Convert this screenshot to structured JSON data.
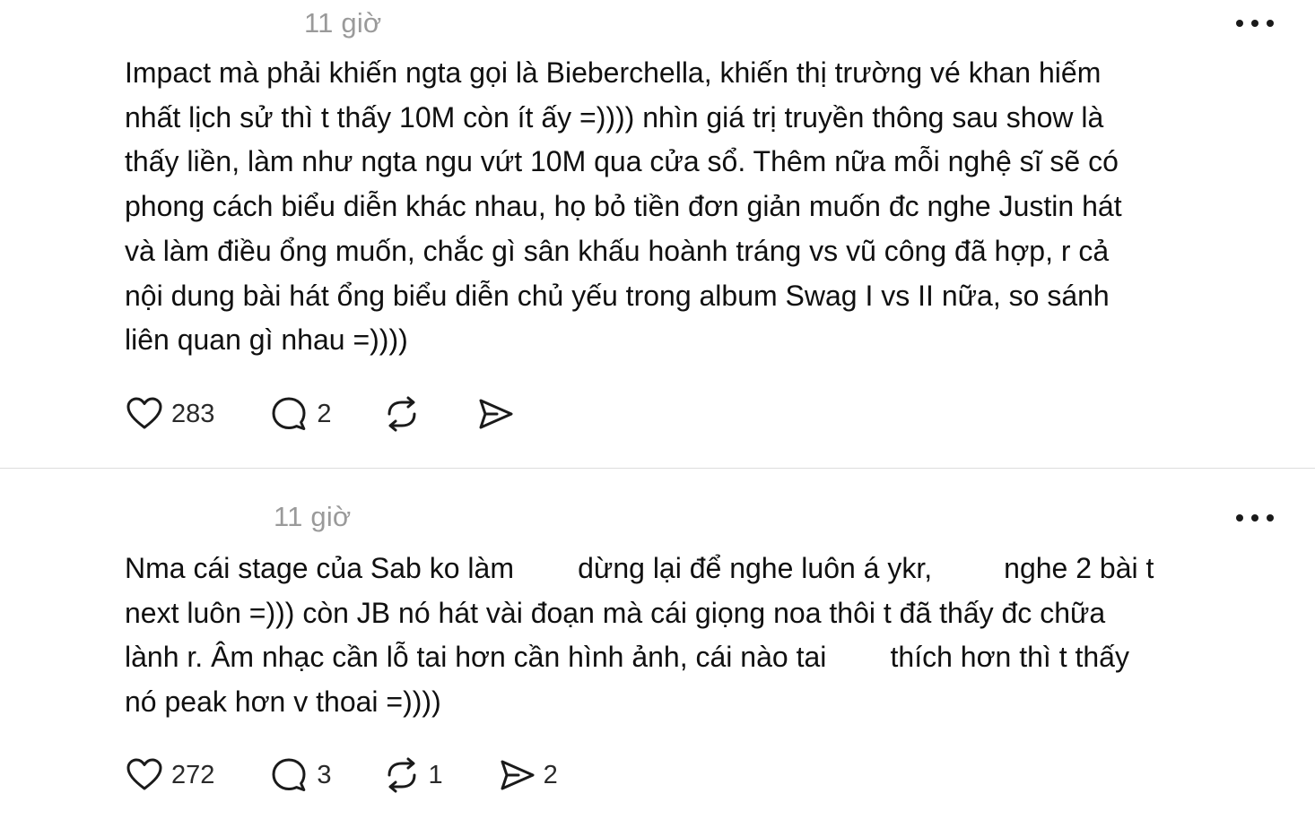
{
  "posts": [
    {
      "timestamp": "11 giờ",
      "lines": [
        "Impact mà phải khiến ngta gọi là Bieberchella, khiến thị trường vé khan hiếm",
        "nhất lịch sử thì t thấy 10M còn ít ấy =)))) nhìn giá trị truyền thông sau show là",
        "thấy liền, làm như ngta ngu vứt 10M qua cửa sổ. Thêm nữa mỗi nghệ sĩ sẽ có",
        "phong cách biểu diễn khác nhau, họ bỏ tiền đơn giản muốn đc nghe Justin hát",
        "và làm điều ổng muốn, chắc gì sân khấu hoành tráng vs vũ công đã hợp, r cả",
        "nội dung bài hát ổng biểu diễn chủ yếu trong album Swag I vs II nữa, so sánh",
        "liên quan gì nhau =))))"
      ],
      "likes": "283",
      "replies": "2",
      "reposts": "",
      "shares": ""
    },
    {
      "timestamp": "11 giờ",
      "lines": [
        "Nma cái stage của Sab ko làm        dừng lại để nghe luôn á ykr,         nghe 2 bài t",
        "next luôn =))) còn JB nó hát vài đoạn mà cái giọng noa thôi t đã thấy đc chữa",
        "lành r. Âm nhạc cần lỗ tai hơn cần hình ảnh, cái nào tai        thích hơn thì t thấy",
        "nó peak hơn v thoai =))))"
      ],
      "likes": "272",
      "replies": "3",
      "reposts": "1",
      "shares": "2"
    }
  ],
  "icons": {
    "like": "heart-icon",
    "reply": "comment-icon",
    "repost": "repost-icon",
    "share": "share-icon",
    "more": "more-icon"
  }
}
